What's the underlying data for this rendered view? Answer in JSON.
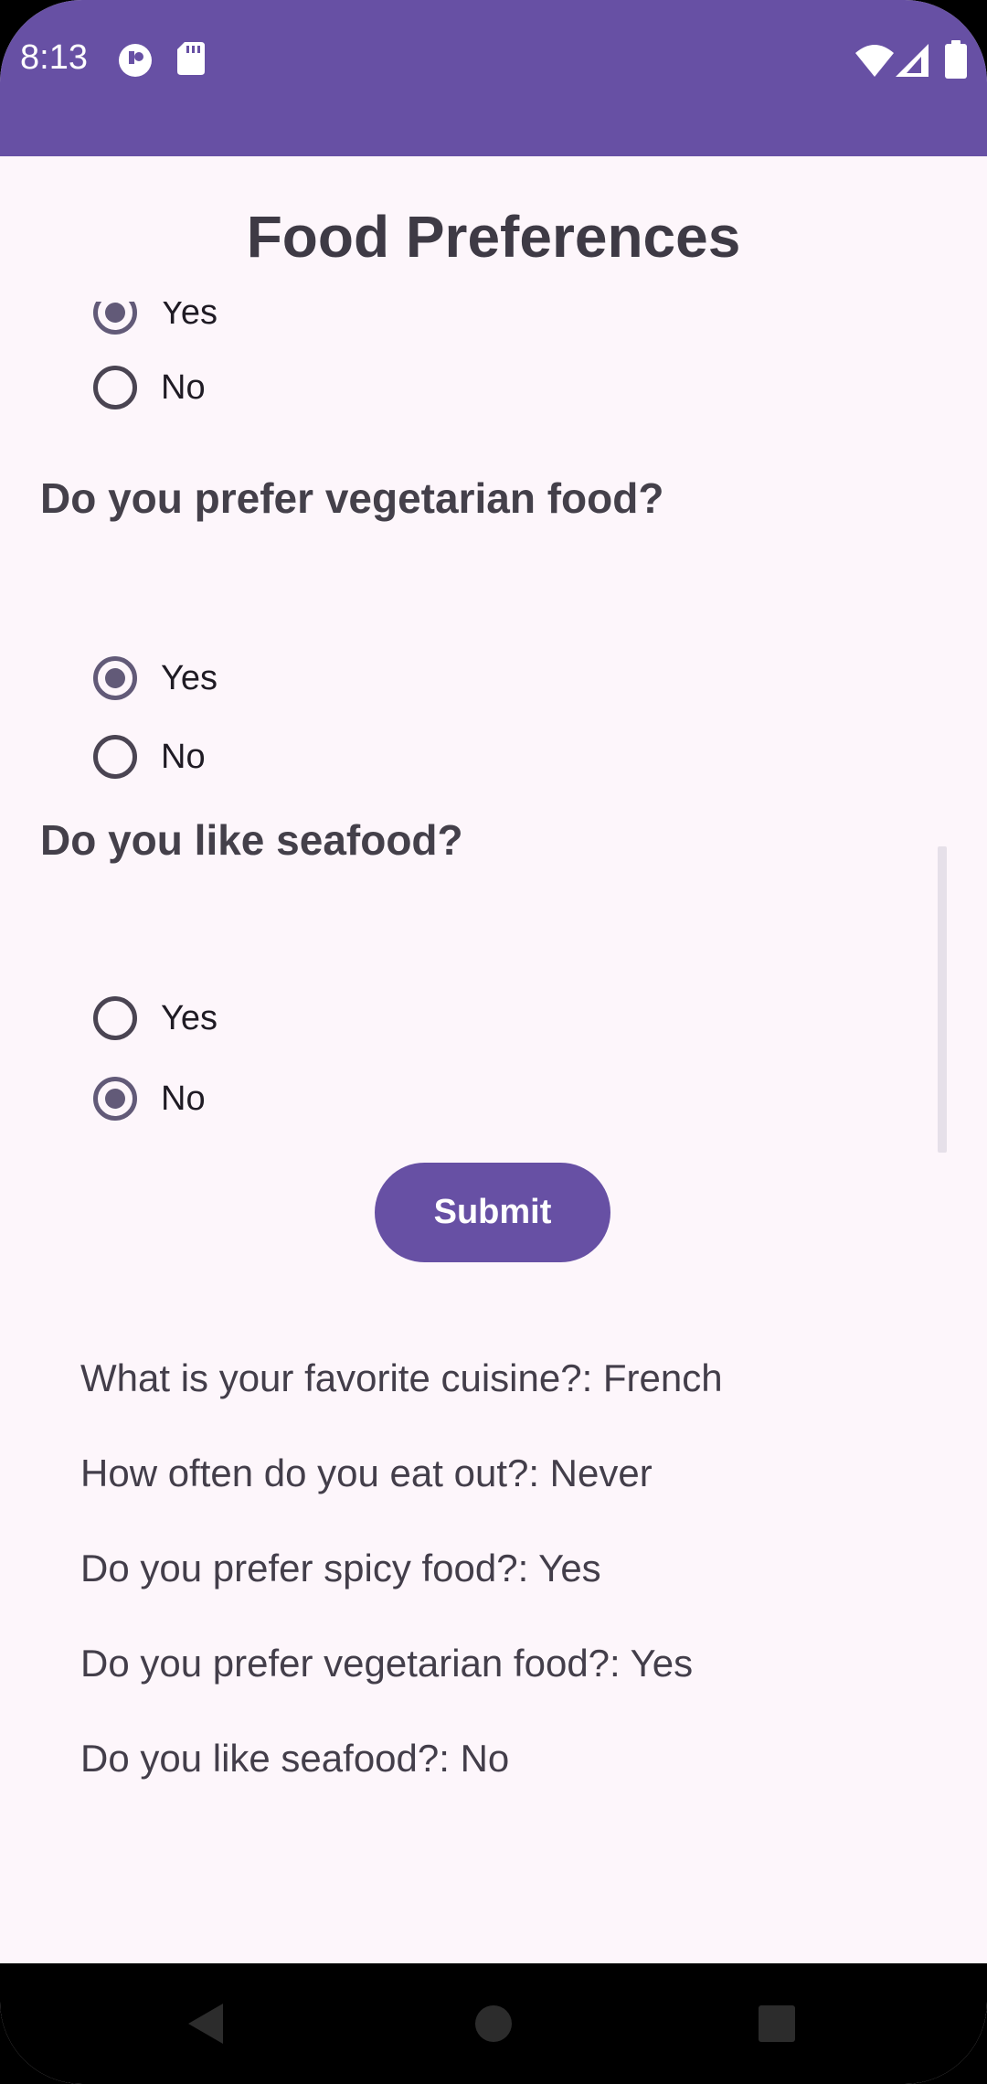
{
  "status_bar": {
    "time": "8:13",
    "left_icons": [
      "notification-app-icon",
      "sd-card-icon"
    ],
    "right_icons": [
      "wifi-icon",
      "signal-icon",
      "battery-icon"
    ]
  },
  "app": {
    "title": "Food Preferences"
  },
  "questions": [
    {
      "label": "",
      "options": [
        {
          "label": "Yes",
          "checked": true
        },
        {
          "label": "No",
          "checked": false
        }
      ]
    },
    {
      "label": "Do you prefer vegetarian food?",
      "options": [
        {
          "label": "Yes",
          "checked": true
        },
        {
          "label": "No",
          "checked": false
        }
      ]
    },
    {
      "label": "Do you like seafood?",
      "options": [
        {
          "label": "Yes",
          "checked": false
        },
        {
          "label": "No",
          "checked": true
        }
      ]
    }
  ],
  "submit": {
    "label": "Submit"
  },
  "results": [
    "What is your favorite cuisine?: French",
    "How often do you eat out?: Never",
    "Do you prefer spicy food?: Yes",
    "Do you prefer vegetarian food?: Yes",
    "Do you like seafood?: No"
  ],
  "colors": {
    "primary": "#6750a4",
    "background": "#fdf6fb",
    "radio_checked": "#625a78"
  }
}
